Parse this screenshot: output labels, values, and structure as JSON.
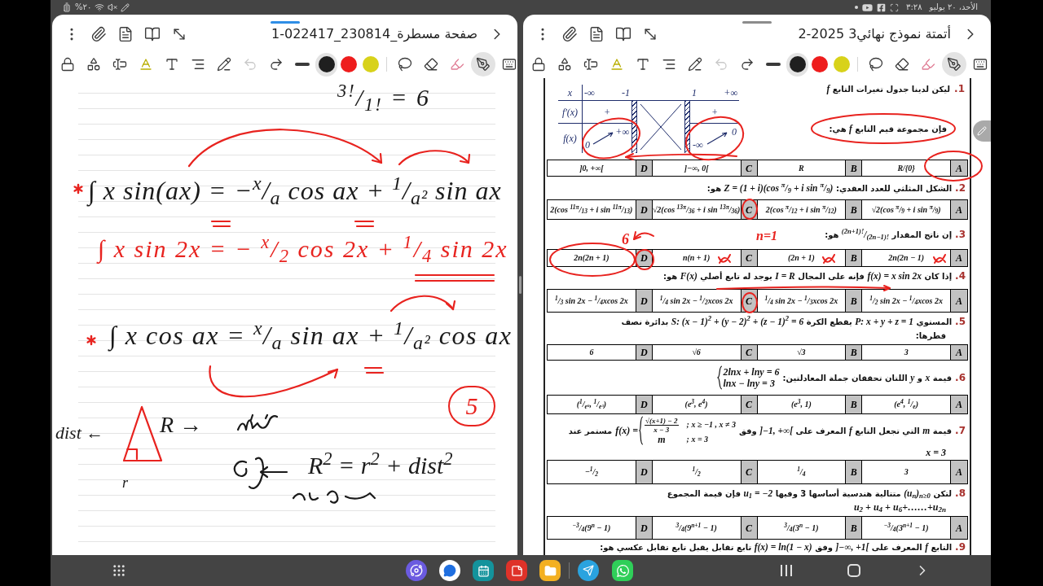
{
  "status_bar": {
    "battery": "%٢٠",
    "time": "٣:٢٨",
    "date": "الأحد، ٢٠ يوليو"
  },
  "left_window": {
    "kind": "notes",
    "title": "صفحة مسطرة_230814_022417-1",
    "focused": true,
    "toolbar": {
      "tools": [
        {
          "selected": false,
          "disabled": false
        },
        {
          "selected": false,
          "disabled": false
        },
        {
          "selected": false,
          "disabled": false
        },
        {
          "selected": false,
          "disabled": false
        },
        {
          "selected": false,
          "disabled": false
        },
        {
          "selected": false,
          "disabled": false
        },
        {
          "selected": false,
          "disabled": false
        },
        {
          "selected": false,
          "disabled": true
        },
        {
          "selected": false,
          "disabled": false
        },
        {
          "selected": false,
          "disabled": false
        },
        {
          "selected": false,
          "disabled": false
        },
        {
          "selected": false,
          "disabled": false
        },
        {
          "selected": false,
          "disabled": false
        },
        {
          "selected": true,
          "disabled": false
        },
        {
          "selected": false,
          "disabled": false
        }
      ],
      "colors": [
        {
          "color": "#1f1f1f",
          "selected": true
        },
        {
          "color": "#ee1d1d",
          "selected": false
        },
        {
          "color": "#d8d21a",
          "selected": false
        }
      ]
    },
    "ink": [
      {
        "kind": "formula",
        "color": "#1a1a1a",
        "text": "$^{3!}$/$_{1!}$ = 6"
      },
      {
        "kind": "formula",
        "color": "#1a1a1a",
        "text": "∫ x sin(ax) = −$^{x}$/$_{a}$ cos ax + $^{1}$/$_{a²}$ sin ax"
      },
      {
        "kind": "formula",
        "color": "#e8231f",
        "text": "∫ x sin 2x = − $^{x}$/$_{2}$ cos 2x + $^{1}$/$_{4}$ sin 2x"
      },
      {
        "kind": "formula",
        "color": "#1a1a1a",
        "text": "∫ x cos ax = $^{x}$/$_{a}$ sin ax + $^{1}$/$_{a²}$ cos ax"
      },
      {
        "kind": "circled",
        "color": "#e8231f",
        "text": "5"
      },
      {
        "kind": "formula",
        "color": "#1a1a1a",
        "text": "dist ←"
      },
      {
        "kind": "formula",
        "color": "#1a1a1a",
        "text": "R →"
      },
      {
        "kind": "formula",
        "color": "#1a1a1a",
        "text": "R$^{2}$ = r$^{2}$ + dist$^{2}$"
      },
      {
        "kind": "formula",
        "color": "#1a1a1a",
        "text": "r"
      }
    ]
  },
  "right_window": {
    "kind": "pdf",
    "title": "أتمتة نموذج نهائي3 2025-2",
    "focused": false,
    "toolbar": {
      "tools": [
        {
          "selected": false,
          "disabled": false
        },
        {
          "selected": false,
          "disabled": false
        },
        {
          "selected": false,
          "disabled": false
        },
        {
          "selected": false,
          "disabled": false
        },
        {
          "selected": false,
          "disabled": false
        },
        {
          "selected": false,
          "disabled": false
        },
        {
          "selected": false,
          "disabled": false
        },
        {
          "selected": false,
          "disabled": true
        },
        {
          "selected": false,
          "disabled": false
        },
        {
          "selected": false,
          "disabled": false
        },
        {
          "selected": false,
          "disabled": false
        },
        {
          "selected": false,
          "disabled": false
        },
        {
          "selected": false,
          "disabled": false
        },
        {
          "selected": true,
          "disabled": false
        },
        {
          "selected": false,
          "disabled": false
        }
      ],
      "colors": [
        {
          "color": "#1f1f1f",
          "selected": true
        },
        {
          "color": "#ee1d1d",
          "selected": false
        },
        {
          "color": "#d8d21a",
          "selected": false
        }
      ]
    },
    "exam": {
      "questions": [
        {
          "number": "1.",
          "lines": [
            {
              "kind": "text",
              "text": "ليكن لدينا جدول تغيرات التابع *f*"
            },
            {
              "kind": "text",
              "text": "فإن مجموعة قيم التابع *f* هي:"
            }
          ],
          "variation_table": {
            "variable": "x",
            "points": [
              "-∞",
              "-1",
              "1",
              "+∞"
            ],
            "rows": [
              {
                "kind": "sign",
                "label": "f'(x)",
                "left": "+",
                "right": "+"
              },
              {
                "kind": "variation",
                "label": "f(x)",
                "left_from": "0",
                "left_to": "+∞",
                "right_from": "-∞",
                "right_to": "0"
              }
            ]
          },
          "options": [
            {
              "letter": "D",
              "value": "]0, +∞["
            },
            {
              "letter": "C",
              "value": "]−∞, 0["
            },
            {
              "letter": "B",
              "value": "R"
            },
            {
              "letter": "A",
              "value": "R/{0}"
            }
          ]
        },
        {
          "number": "2.",
          "lines": [
            {
              "kind": "text",
              "text": "الشكل المثلثي للعدد العقدي: *Z = (1 + i)(cos $^{π}$/$_{9}$ + i sin $^{π}$/$_{9}$)* هو:"
            }
          ],
          "options": [
            {
              "letter": "D",
              "value": "2(cos $^{11π}$/$_{13}$ + i sin $^{11π}$/$_{13}$)"
            },
            {
              "letter": "C",
              "value": "√2(cos $^{13π}$/$_{36}$ + i sin $^{13π}$/$_{36}$)"
            },
            {
              "letter": "B",
              "value": "2(cos $^{π}$/$_{12}$ + i sin $^{π}$/$_{12}$)"
            },
            {
              "letter": "A",
              "value": "√2(cos $^{π}$/$_{9}$ + i sin $^{π}$/$_{9}$)"
            }
          ]
        },
        {
          "number": "3.",
          "lines": [
            {
              "kind": "text",
              "text": "إن ناتج المقدار *$^{(2n+1)!}$/$_{(2n−1)!}$* هو:"
            }
          ],
          "options": [
            {
              "letter": "D",
              "value": "2n(2n + 1)"
            },
            {
              "letter": "C",
              "value": "n(n + 1)"
            },
            {
              "letter": "B",
              "value": "(2n + 1)"
            },
            {
              "letter": "A",
              "value": "2n(2n − 1)"
            }
          ]
        },
        {
          "number": "4.",
          "lines": [
            {
              "kind": "text",
              "text": "إذا كان *f(x) = x sin 2x* فإنه على المجال *I = R* يوجد له تابع أصلي *F(x)* هو:"
            }
          ],
          "options": [
            {
              "letter": "D",
              "value": "$^{1}$/$_{3}$ sin 2x − $^{1}$/$_{4}$xcos 2x"
            },
            {
              "letter": "C",
              "value": "$^{1}$/$_{4}$ sin 2x − $^{1}$/$_{2}$xcos 2x"
            },
            {
              "letter": "B",
              "value": "$^{1}$/$_{4}$ sin 2x − $^{1}$/$_{3}$xcos 2x"
            },
            {
              "letter": "A",
              "value": "$^{1}$/$_{2}$ sin 2x − $^{1}$/$_{4}$xcos 2x"
            }
          ]
        },
        {
          "number": "5.",
          "lines": [
            {
              "kind": "text",
              "text": "المستوي *P: x + y + z = 1* يقطع الكرة *S: (x − 1)$^{2}$ + (y − 2)$^{2}$ + (z − 1)$^{2}$ = 6* بدائرة نصف"
            },
            {
              "kind": "text",
              "text": "قطرها:"
            }
          ],
          "options": [
            {
              "letter": "D",
              "value": "6"
            },
            {
              "letter": "C",
              "value": "√6"
            },
            {
              "letter": "B",
              "value": "√3"
            },
            {
              "letter": "A",
              "value": "3"
            }
          ]
        },
        {
          "number": "6.",
          "lines": [
            {
              "kind": "text",
              "text": "قيمة *x* و *y* اللتان تحققان جملة المعادلتين:"
            }
          ],
          "system": [
            "2lnx + lny = 6",
            "lnx − lny = 3"
          ],
          "options": [
            {
              "letter": "D",
              "value": "($^{1}$/$_{e⁶}$, $^{1}$/$_{e³}$)"
            },
            {
              "letter": "C",
              "value": "(e$^{3}$, e$^{4}$)"
            },
            {
              "letter": "B",
              "value": "(e$^{3}$, 1)"
            },
            {
              "letter": "A",
              "value": "(e$^{4}$, $^{1}$/$_{e}$)"
            }
          ]
        },
        {
          "number": "7.",
          "lines": [
            {
              "kind": "text",
              "text": "قيمة *m* التي تجعل التابع *f* المعرف على *]−1, +∞[* وفق"
            },
            {
              "kind": "math",
              "text": "x = 3"
            }
          ],
          "piecewise": {
            "lhs": "f(x) =",
            "cases": [
              {
                "numerator": "√(x+1) − 2",
                "denominator": "x − 3",
                "cond": "; x ≥ −1 , x ≠ 3"
              },
              {
                "expr": "m",
                "cond": "; x = 3"
              }
            ],
            "after": "مستمر عند"
          },
          "options": [
            {
              "letter": "D",
              "value": "−$^{1}$/$_{2}$"
            },
            {
              "letter": "C",
              "value": "$^{1}$/$_{2}$"
            },
            {
              "letter": "B",
              "value": "$^{1}$/$_{4}$"
            },
            {
              "letter": "A",
              "value": "3"
            }
          ]
        },
        {
          "number": "8.",
          "lines": [
            {
              "kind": "text",
              "text": "لتكن *(u$_{n}$)$_{n≥0}$* متتالية هندسية أساسها 3 وفيها *u$_{1}$ = −2* فإن قيمة المجموع"
            },
            {
              "kind": "math",
              "text": "u$_{2}$ + u$_{4}$ + u$_{6}$+……+u$_{2n}$"
            }
          ],
          "options": [
            {
              "letter": "D",
              "value": "$^{−3}$/$_{4}$(9$^{n}$ − 1)"
            },
            {
              "letter": "C",
              "value": "$^{3}$/$_{4}$(9$^{n+1}$ − 1)"
            },
            {
              "letter": "B",
              "value": "$^{3}$/$_{4}$(3$^{n}$ − 1)"
            },
            {
              "letter": "A",
              "value": "$^{−3}$/$_{4}$(3$^{n+1}$ − 1)"
            }
          ]
        },
        {
          "number": "9.",
          "lines": [
            {
              "kind": "text",
              "text": "التابع *f* المعرف على *]−∞, +1[* وفق *f(x) = ln(1 − x)* تابع تقابل يقبل تابع تقابل عكسي هو:"
            }
          ]
        }
      ],
      "annotations": [
        {
          "text": "6"
        },
        {
          "text": "n=1"
        }
      ]
    }
  }
}
